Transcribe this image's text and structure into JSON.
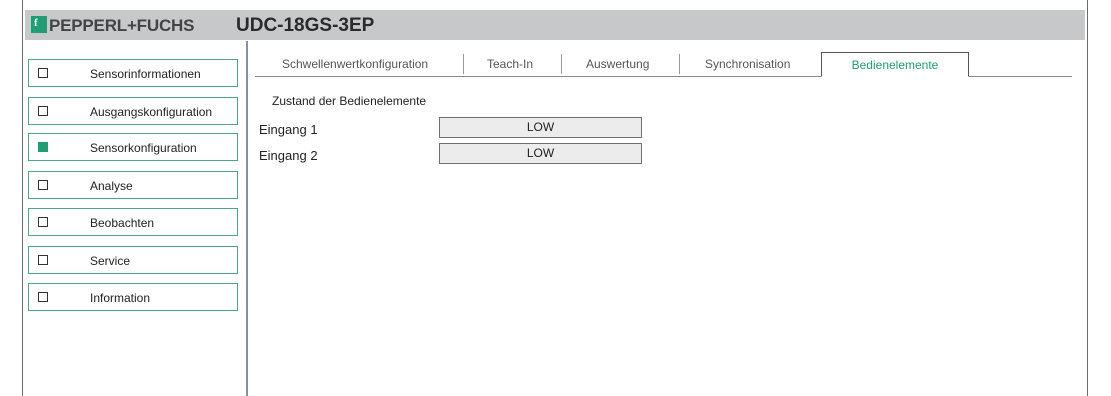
{
  "header": {
    "logo_glyph": "f",
    "brand": "PEPPERL+FUCHS",
    "device": "UDC-18GS-3EP"
  },
  "sidebar": {
    "items": [
      {
        "label": "Sensorinformationen",
        "checked": false
      },
      {
        "label": "Ausgangskonfiguration",
        "checked": false
      },
      {
        "label": "Sensorkonfiguration",
        "checked": true
      },
      {
        "label": "Analyse",
        "checked": false
      },
      {
        "label": "Beobachten",
        "checked": false
      },
      {
        "label": "Service",
        "checked": false
      },
      {
        "label": "Information",
        "checked": false
      }
    ]
  },
  "tabs": [
    {
      "label": "Schwellenwertkonfiguration",
      "active": false
    },
    {
      "label": "Teach-In",
      "active": false
    },
    {
      "label": "Auswertung",
      "active": false
    },
    {
      "label": "Synchronisation",
      "active": false
    },
    {
      "label": "Bedienelemente",
      "active": true
    }
  ],
  "main": {
    "section_title": "Zustand der Bedienelemente",
    "rows": [
      {
        "label": "Eingang 1",
        "value": "LOW"
      },
      {
        "label": "Eingang 2",
        "value": "LOW"
      }
    ]
  },
  "colors": {
    "accent": "#1f9d74",
    "header_bg": "#c6c8c9",
    "sidebar_border": "#4aa88a",
    "value_bg": "#ececec"
  }
}
